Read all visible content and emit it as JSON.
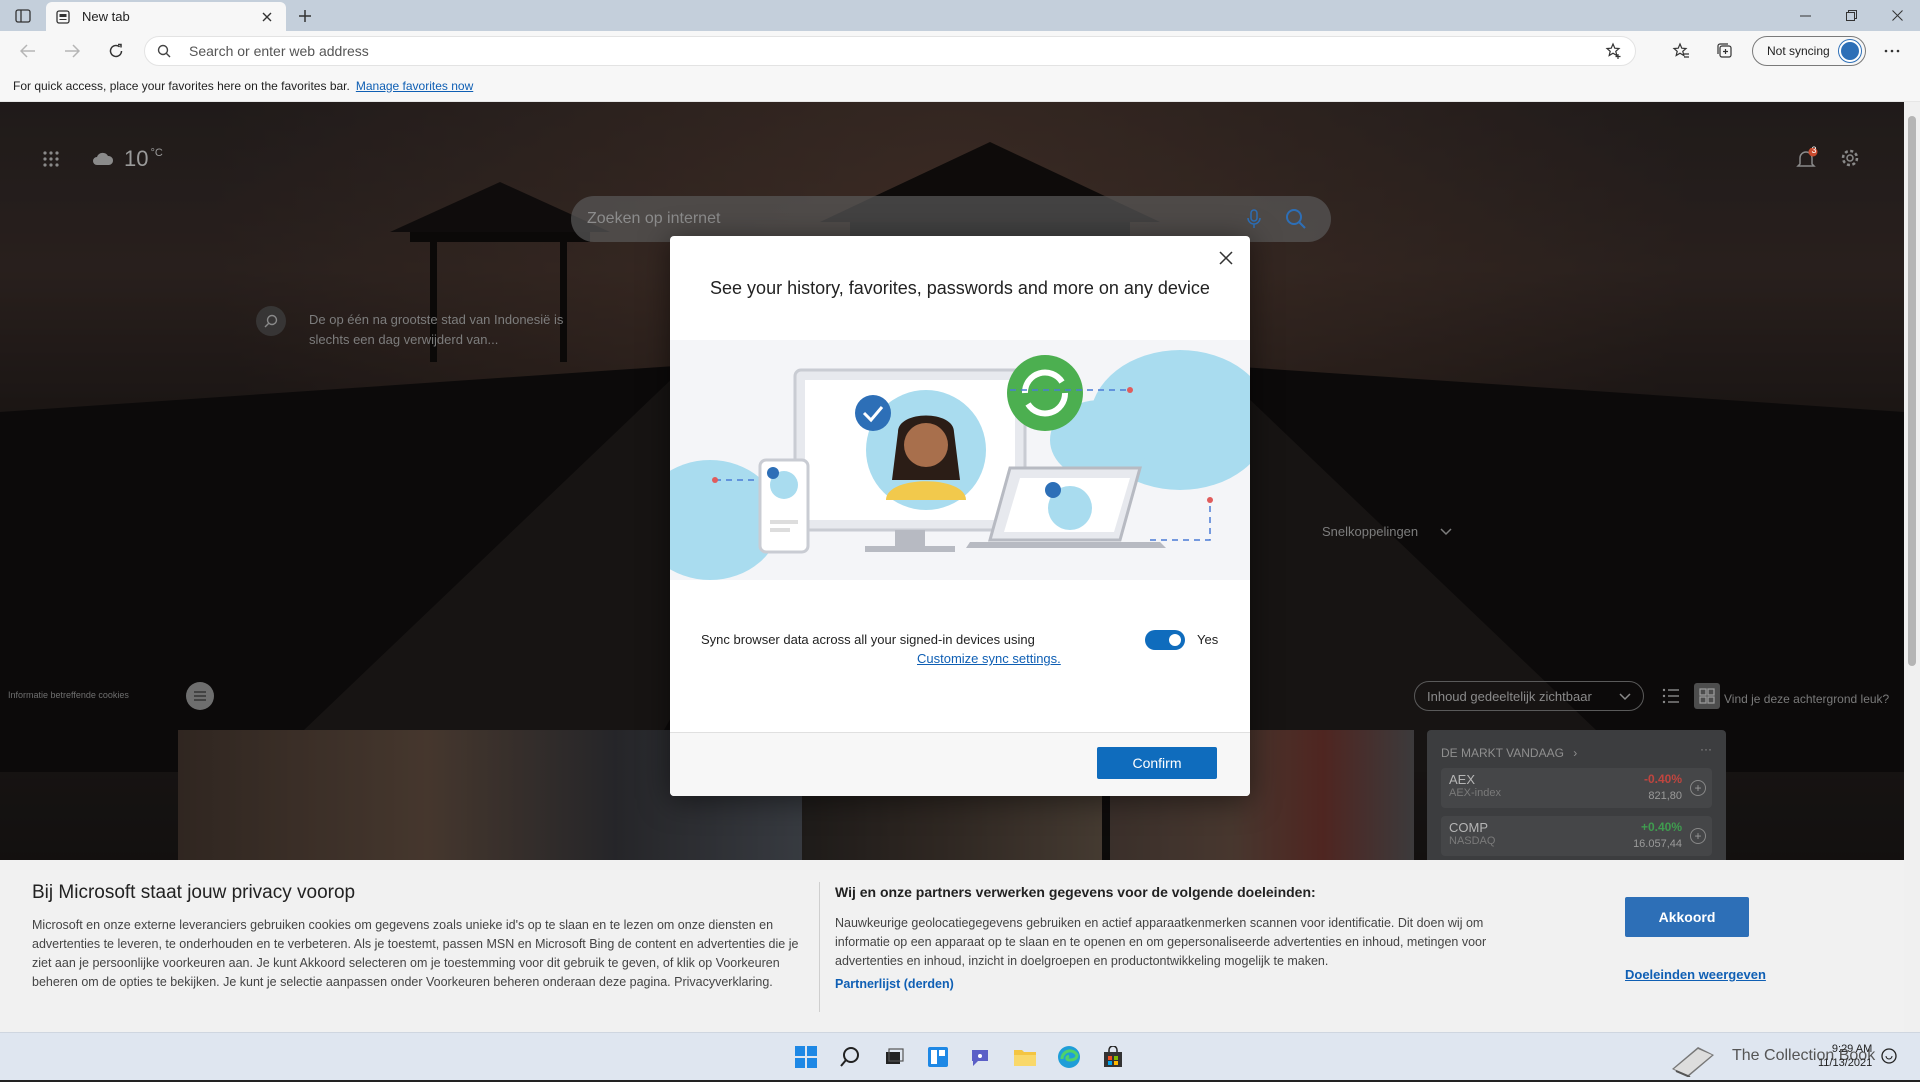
{
  "browser": {
    "tab_title": "New tab",
    "address_placeholder": "Search or enter web address",
    "sync_label": "Not syncing",
    "favbar_text": "For quick access, place your favorites here on the favorites bar.",
    "favbar_link": "Manage favorites now"
  },
  "newtab": {
    "temperature": "10",
    "temp_unit": "°C",
    "search_placeholder": "Zoeken op internet",
    "notification_count": "3",
    "trivia": "De op één na grootste stad van Indonesië is slechts een dag verwijderd van...",
    "quick_links": "Snelkoppelingen",
    "cookie_info": "Informatie betreffende cookies",
    "content_visibility": "Inhoud gedeeltelijk zichtbaar",
    "background_prompt": "Vind je deze achtergrond leuk?",
    "market": {
      "title": "DE MARKT VANDAAG",
      "rows": [
        {
          "symbol": "AEX",
          "name": "AEX-index",
          "change": "-0.40%",
          "value": "821,80"
        },
        {
          "symbol": "COMP",
          "name": "NASDAQ",
          "change": "+0.40%",
          "value": "16.057,44"
        }
      ]
    }
  },
  "modal": {
    "title": "See your history, favorites, passwords and more on any device",
    "sync_text": "Sync browser data across all your signed-in devices using",
    "sync_link": "Customize sync settings.",
    "toggle_label": "Yes",
    "toggle_on": true,
    "confirm_label": "Confirm"
  },
  "privacy": {
    "title": "Bij Microsoft staat jouw privacy voorop",
    "body": "Microsoft en onze externe leveranciers gebruiken cookies om gegevens zoals unieke id's op te slaan en te lezen om onze diensten en advertenties te leveren, te onderhouden en te verbeteren. Als je toestemt, passen MSN en Microsoft Bing de content en advertenties die je ziet aan je persoonlijke voorkeuren aan. Je kunt Akkoord selecteren om je toestemming voor dit gebruik te geven, of klik op Voorkeuren beheren om de opties te bekijken. Je kunt je selectie aanpassen onder Voorkeuren beheren onderaan deze pagina. Privacyverklaring.",
    "partners_title": "Wij en onze partners verwerken gegevens voor de volgende doeleinden:",
    "partners_body": "Nauwkeurige geolocatiegegevens gebruiken en actief apparaatkenmerken scannen voor identificatie. Dit doen wij om informatie op een apparaat op te slaan en te openen en om gepersonaliseerde advertenties en inhoud, metingen voor advertenties en inhoud, inzicht in doelgroepen en productontwikkeling mogelijk te maken.",
    "partners_link": "Partnerlijst (derden)",
    "accept_label": "Akkoord",
    "purposes_link": "Doeleinden weergeven"
  },
  "taskbar": {
    "time": "9:29 AM",
    "date": "11/13/2021",
    "watermark": "The Collection Book"
  },
  "colors": {
    "accent": "#0f6cbd",
    "link": "#0f5fb4",
    "negative": "#c0453f",
    "positive": "#3f9c4f"
  }
}
